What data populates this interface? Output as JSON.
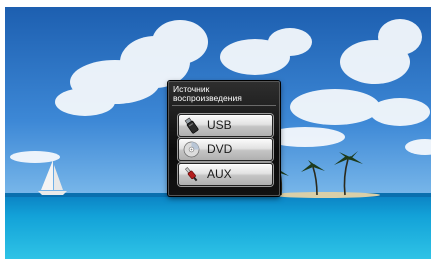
{
  "dialog": {
    "title_line1": "Источник",
    "title_line2": "воспроизведения"
  },
  "sources": [
    {
      "label": "USB",
      "icon": "usb-drive-icon"
    },
    {
      "label": "DVD",
      "icon": "disc-icon"
    },
    {
      "label": "AUX",
      "icon": "aux-cable-icon"
    }
  ],
  "colors": {
    "sky": "#2f7fd0",
    "sea": "#1aa3d8",
    "dialog_bg": "#111111",
    "button_face": "#e0e0e0"
  }
}
